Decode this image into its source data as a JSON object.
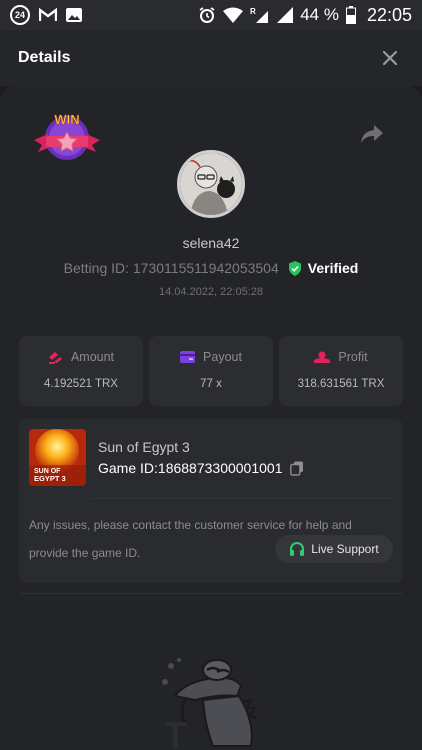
{
  "status_bar": {
    "notification_count": "24",
    "battery": "44 %",
    "time": "22:05"
  },
  "header": {
    "title": "Details"
  },
  "bet": {
    "win_badge_text": "WIN",
    "username": "selena42",
    "betting_id_text": "Betting ID: 1730115511942053504",
    "verified_label": "Verified",
    "date": "14.04.2022, 22:05:28"
  },
  "stats": [
    {
      "label": "Amount",
      "value": "4.192521 TRX",
      "icon": "amount-icon"
    },
    {
      "label": "Payout",
      "value": "77 x",
      "icon": "wallet-icon"
    },
    {
      "label": "Profit",
      "value": "318.631561 TRX",
      "icon": "profit-icon"
    }
  ],
  "game": {
    "thumb_text_line1": "SUN OF",
    "thumb_text_line2": "EGYPT 3",
    "name": "Sun of Egypt 3",
    "game_id_text": "Game ID:1868873300001001",
    "support_text": "Any issues, please contact the customer service for help and provide the game ID.",
    "live_support_label": "Live Support"
  },
  "colors": {
    "accent_green": "#2ecc71",
    "accent_pink": "#e0245e",
    "accent_purple": "#7b3fe4",
    "background": "#1b1c1f",
    "card": "#232427"
  }
}
